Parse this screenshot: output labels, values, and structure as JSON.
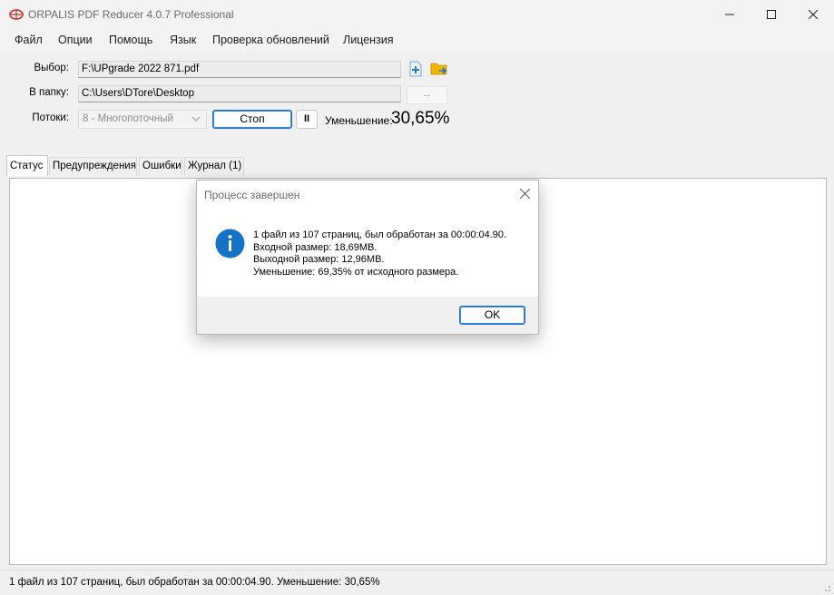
{
  "window": {
    "title": "ORPALIS PDF Reducer 4.0.7 Professional"
  },
  "menu": {
    "items": [
      "Файл",
      "Опции",
      "Помощь",
      "Язык",
      "Проверка обновлений",
      "Лицензия"
    ]
  },
  "form": {
    "select_label": "Выбор:",
    "select_value": "F:\\UPgrade 2022 871.pdf",
    "folder_label": "В папку:",
    "folder_value": "C:\\Users\\DTore\\Desktop",
    "browse_label": "...",
    "threads_label": "Потоки:",
    "threads_value": "8 - Многопоточный",
    "stop_label": "Стоп",
    "pause_label": "II",
    "reduction_label": "Уменьшение:",
    "reduction_value": "30,65%"
  },
  "tabs": [
    "Статус",
    "Предупреждения",
    "Ошибки",
    "Журнал (1)"
  ],
  "status_bar": {
    "text": "1 файл из 107 страниц, был обработан за 00:00:04.90. Уменьшение: 30,65%"
  },
  "dialog": {
    "title": "Процесс завершен",
    "lines": [
      "1 файл из 107 страниц, был обработан за 00:00:04.90.",
      "Входной размер: 18,69MB.",
      "Выходной размер: 12,96MB.",
      "Уменьшение: 69,35% от исходного размера."
    ],
    "ok_label": "OK"
  },
  "colors": {
    "accent": "#1a6fcf",
    "info_icon": "#1573c7",
    "folder_icon": "#f2b600",
    "add_icon": "#2d7ad6"
  },
  "icons": [
    "app-logo-icon",
    "minimize-icon",
    "maximize-icon",
    "close-icon",
    "add-file-icon",
    "open-folder-icon",
    "chevron-down-icon",
    "info-icon",
    "size-grip-icon"
  ]
}
